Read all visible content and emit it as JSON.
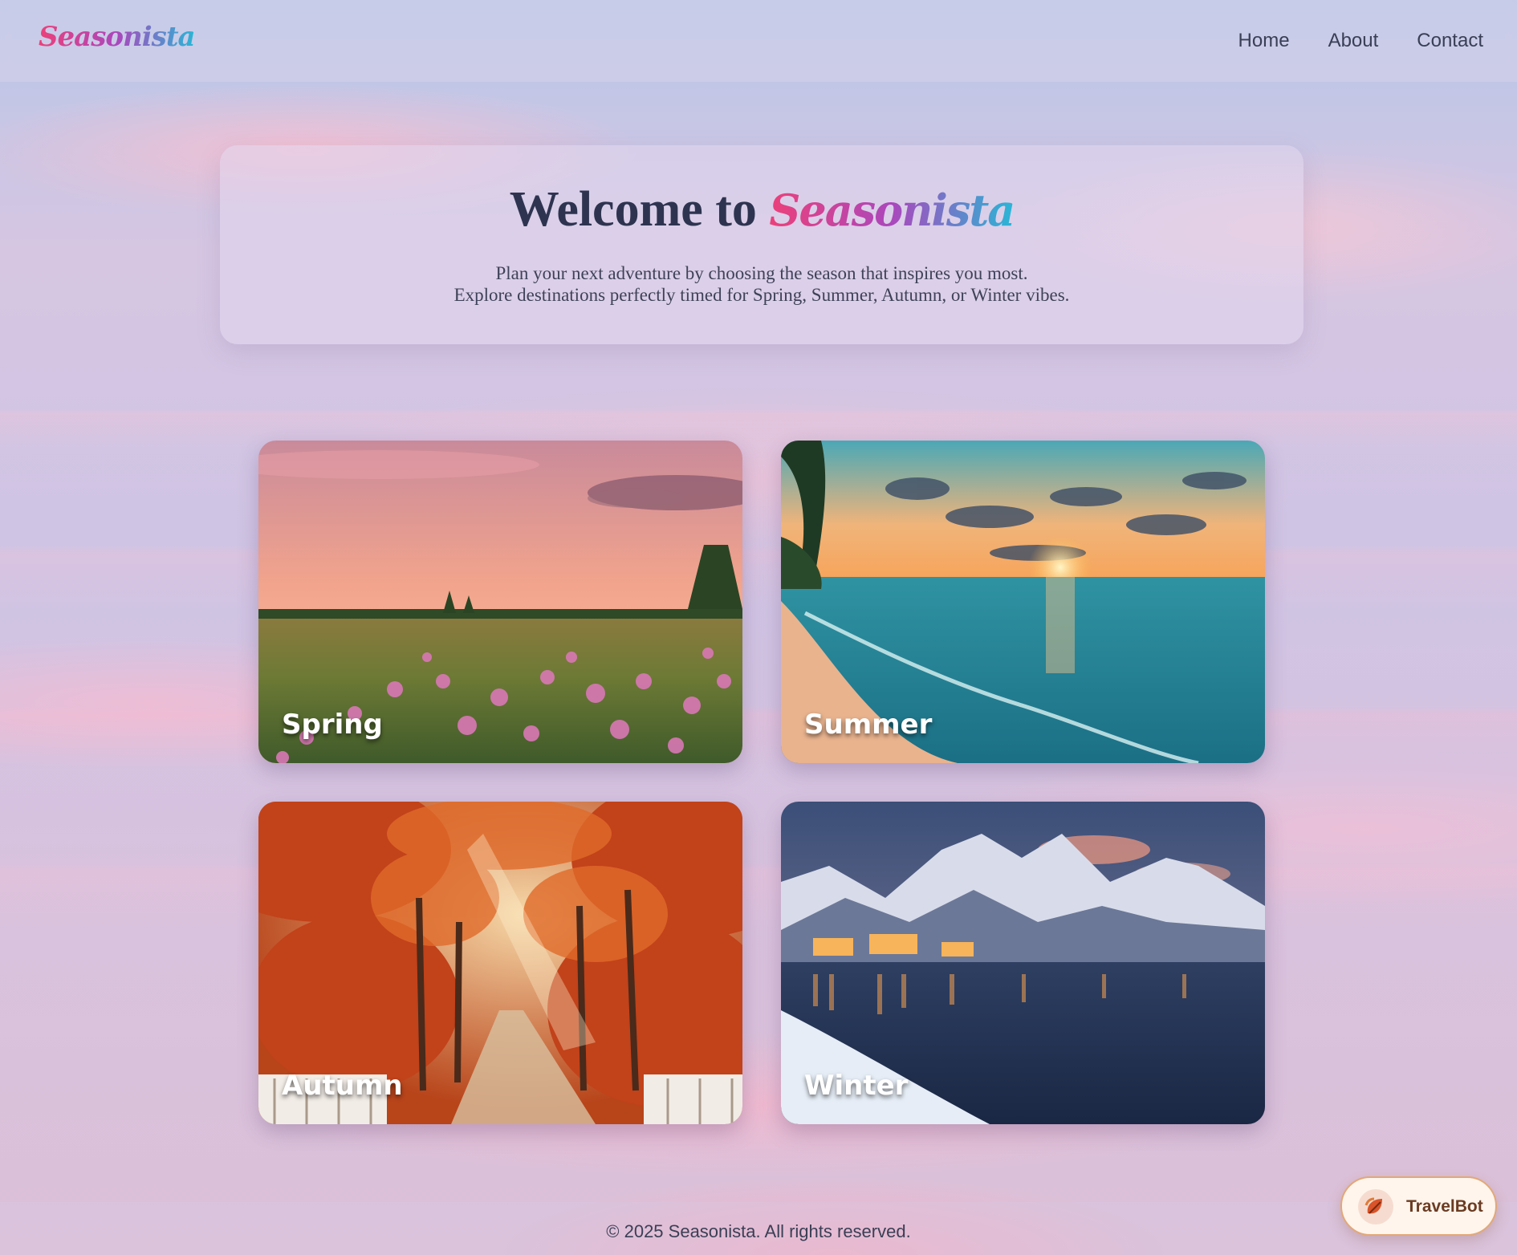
{
  "brand": {
    "name": "Seasonista"
  },
  "nav": {
    "links": [
      {
        "label": "Home"
      },
      {
        "label": "About"
      },
      {
        "label": "Contact"
      }
    ]
  },
  "hero": {
    "title_prefix": "Welcome to",
    "title_brand": "Seasonista",
    "subtitle_line1": "Plan your next adventure by choosing the season that inspires you most.",
    "subtitle_line2": "Explore destinations perfectly timed for Spring, Summer, Autumn, or Winter vibes."
  },
  "seasons": [
    {
      "label": "Spring"
    },
    {
      "label": "Summer"
    },
    {
      "label": "Autumn"
    },
    {
      "label": "Winter"
    }
  ],
  "footer": {
    "text": "© 2025 Seasonista. All rights reserved."
  },
  "chatbot": {
    "label": "TravelBot",
    "icon": "leaf-icon"
  },
  "colors": {
    "brand_gradient": [
      "#ec407a",
      "#ab47bc",
      "#29b6d6"
    ],
    "text_dark": "#2e3450",
    "chatbot_border": "#e2a877"
  }
}
